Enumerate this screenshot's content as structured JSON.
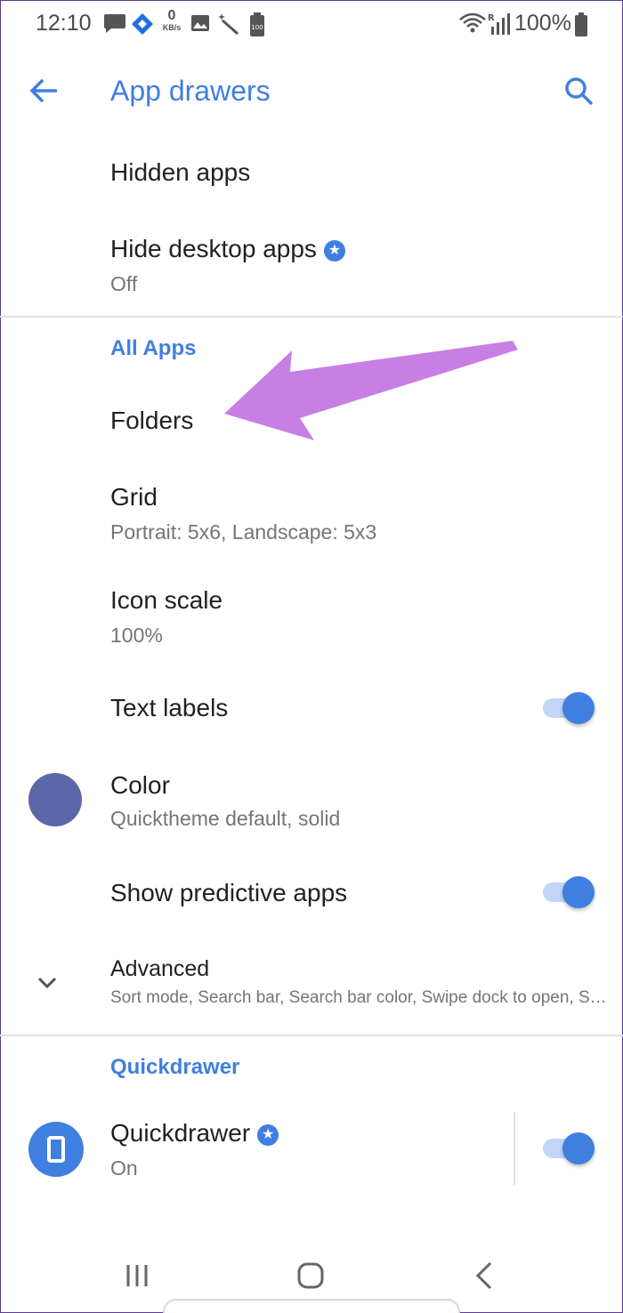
{
  "status_bar": {
    "time": "12:10",
    "speed_value": "0",
    "speed_unit": "KB/s",
    "battery_percent": "100%",
    "icons": [
      "message-icon",
      "app-diamond-icon",
      "image-icon",
      "magic-wand-icon",
      "battery-saver-icon",
      "wifi-icon",
      "signal-icon",
      "battery-icon"
    ]
  },
  "toolbar": {
    "title": "App drawers",
    "back_icon": "back-arrow-icon",
    "search_icon": "search-icon"
  },
  "items": {
    "hidden_apps": {
      "title": "Hidden apps"
    },
    "hide_desktop_apps": {
      "title": "Hide desktop apps",
      "subtitle": "Off",
      "badge": "★"
    },
    "folders": {
      "title": "Folders"
    },
    "grid": {
      "title": "Grid",
      "subtitle": "Portrait: 5x6, Landscape: 5x3"
    },
    "icon_scale": {
      "title": "Icon scale",
      "subtitle": "100%"
    },
    "text_labels": {
      "title": "Text labels",
      "enabled": true
    },
    "color": {
      "title": "Color",
      "subtitle": "Quicktheme default, solid",
      "swatch": "#5c67aa"
    },
    "show_predictive_apps": {
      "title": "Show predictive apps",
      "enabled": true
    },
    "advanced": {
      "title": "Advanced",
      "subtitle": "Sort mode, Search bar, Search bar color, Swipe dock to open, S…"
    },
    "quickdrawer": {
      "title": "Quickdrawer",
      "subtitle": "On",
      "badge": "★",
      "enabled": true
    }
  },
  "sections": {
    "all_apps": "All Apps",
    "quickdrawer": "Quickdrawer"
  },
  "colors": {
    "accent": "#3f7fe0",
    "annotation_arrow": "#c77fe4"
  }
}
